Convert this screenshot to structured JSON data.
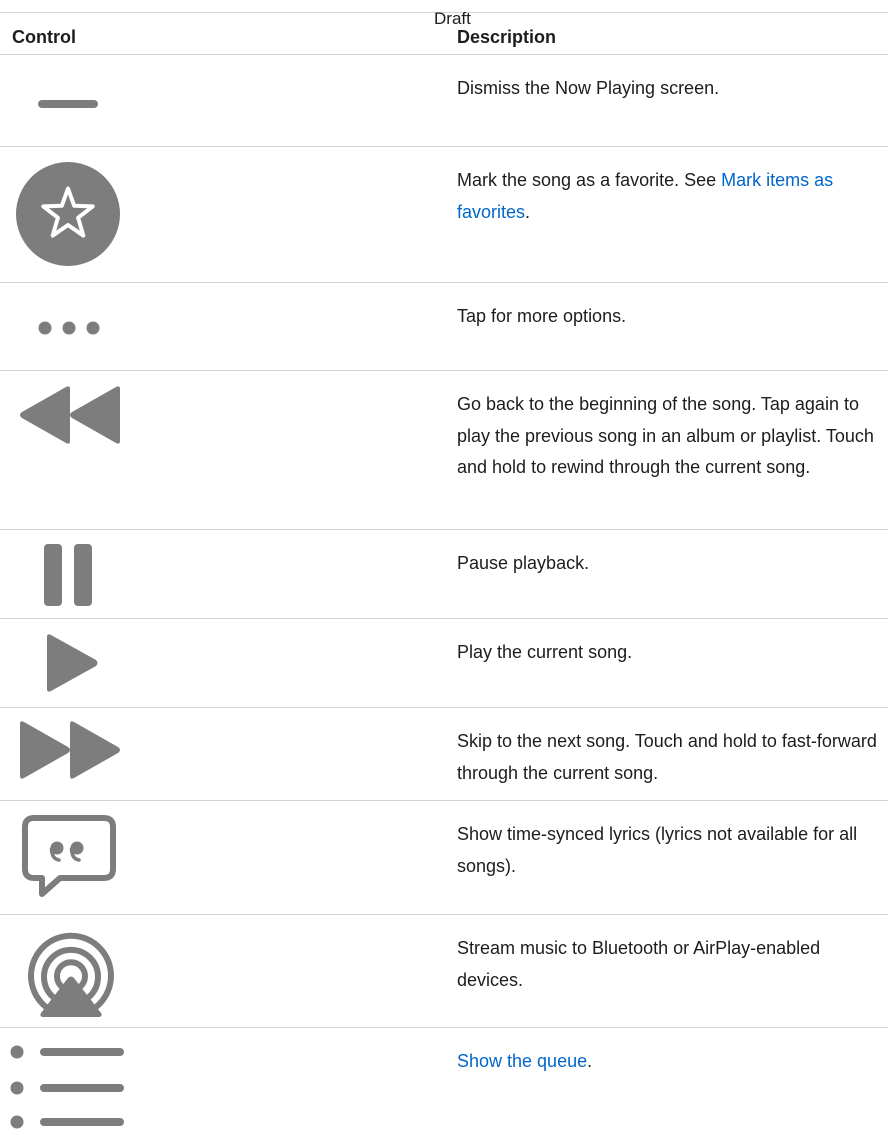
{
  "watermark": "Draft",
  "headers": {
    "control": "Control",
    "description": "Description"
  },
  "icon_color": "#7d7d7d",
  "link_color": "#0066cc",
  "rows": [
    {
      "icon": "dismiss-bar-icon",
      "text_before": "Dismiss the Now Playing screen.",
      "link": "",
      "text_after": ""
    },
    {
      "icon": "favorite-star-icon",
      "text_before": "Mark the song as a favorite. See ",
      "link": "Mark items as favorites",
      "text_after": "."
    },
    {
      "icon": "more-options-icon",
      "text_before": "Tap for more options.",
      "link": "",
      "text_after": ""
    },
    {
      "icon": "rewind-icon",
      "text_before": "Go back to the beginning of the song. Tap again to play the previous song in an album or playlist. Touch and hold to rewind through the current song.",
      "link": "",
      "text_after": ""
    },
    {
      "icon": "pause-icon",
      "text_before": "Pause playback.",
      "link": "",
      "text_after": ""
    },
    {
      "icon": "play-icon",
      "text_before": "Play the current song.",
      "link": "",
      "text_after": ""
    },
    {
      "icon": "fast-forward-icon",
      "text_before": "Skip to the next song. Touch and hold to fast-forward through the current song.",
      "link": "",
      "text_after": ""
    },
    {
      "icon": "lyrics-quote-icon",
      "text_before": "Show time-synced lyrics (lyrics not available for all songs).",
      "link": "",
      "text_after": ""
    },
    {
      "icon": "airplay-icon",
      "text_before": "Stream music to Bluetooth or AirPlay-enabled devices.",
      "link": "",
      "text_after": ""
    },
    {
      "icon": "queue-list-icon",
      "text_before": "",
      "link": "Show the queue",
      "text_after": "."
    }
  ]
}
